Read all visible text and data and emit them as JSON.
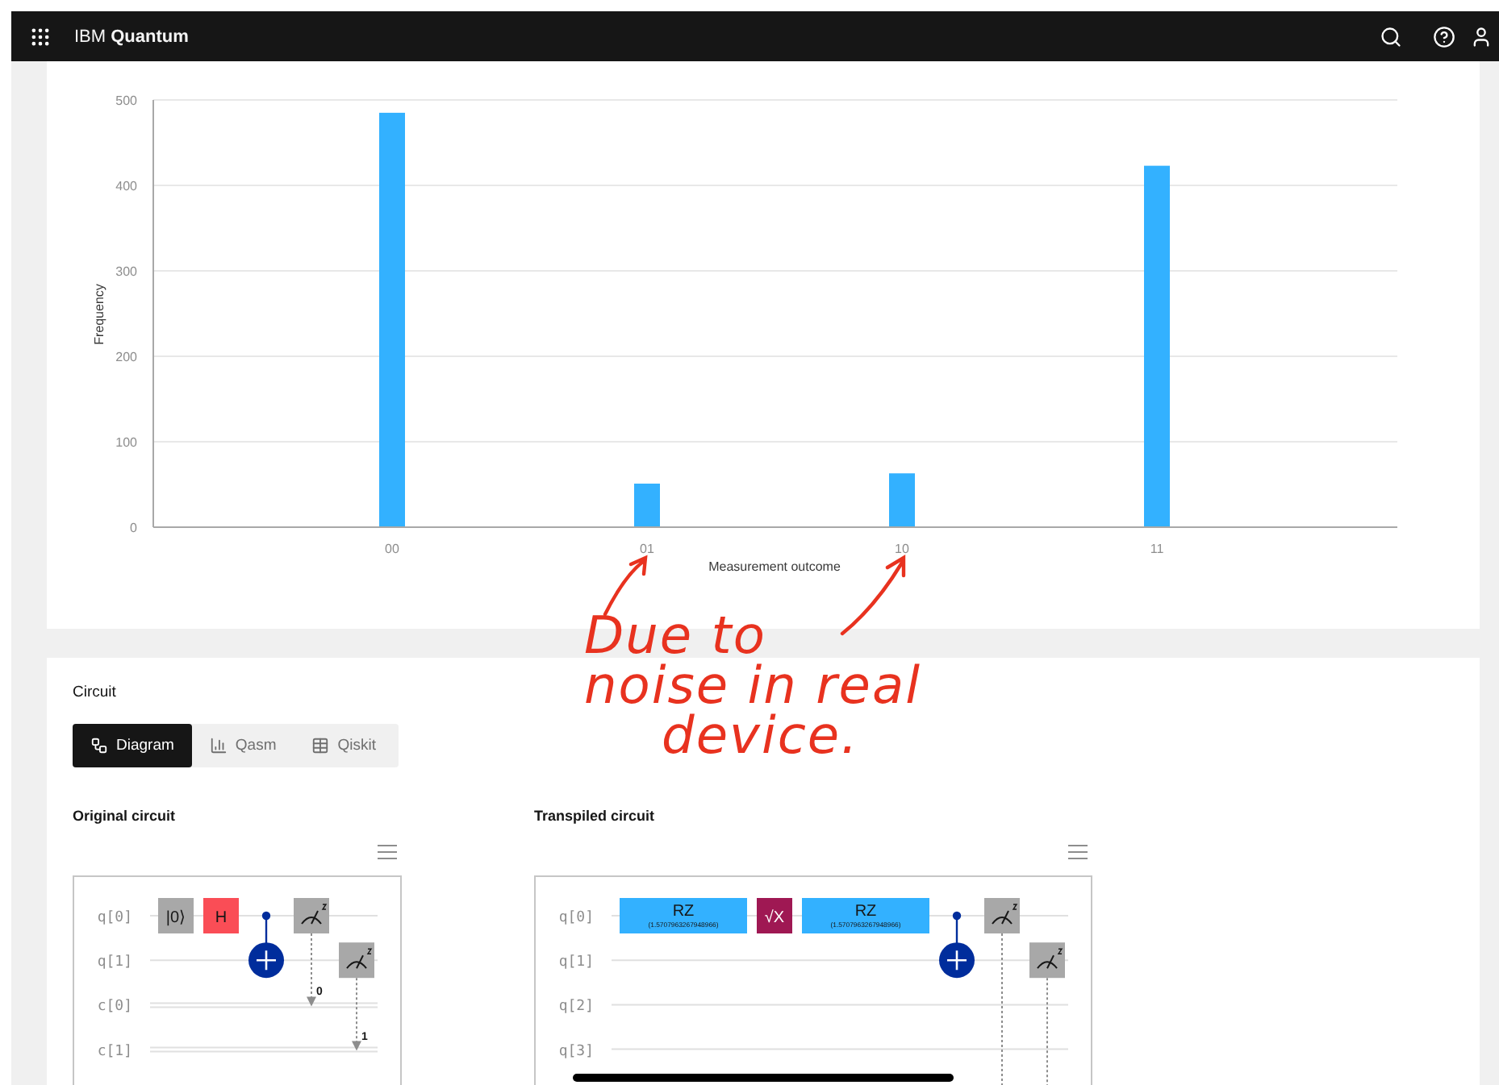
{
  "header": {
    "brand": "IBM **Quantum**"
  },
  "histogram": {
    "chart_data": {
      "type": "bar",
      "xlabel": "Measurement outcome",
      "ylabel": "Frequency",
      "categories": [
        "00",
        "01",
        "10",
        "11"
      ],
      "values": [
        485,
        51,
        63,
        423
      ],
      "ylim": [
        0,
        500
      ],
      "yticks": [
        0,
        100,
        200,
        300,
        400,
        500
      ],
      "grid": true
    }
  },
  "annotation": {
    "lines": [
      "Due to",
      "noise in real",
      "device."
    ]
  },
  "circuit": {
    "title": "Circuit",
    "tabs": [
      {
        "label": "Diagram",
        "selected": true
      },
      {
        "label": "Qasm",
        "selected": false
      },
      {
        "label": "Qiskit",
        "selected": false
      }
    ],
    "panels": [
      {
        "title": "Original circuit",
        "wires": [
          {
            "label": "q[0]",
            "kind": "quantum"
          },
          {
            "label": "q[1]",
            "kind": "quantum"
          },
          {
            "label": "c[0]",
            "kind": "classical"
          },
          {
            "label": "c[1]",
            "kind": "classical"
          }
        ],
        "steps": [
          [
            {
              "kind": "reset",
              "label": "|0⟩"
            },
            {
              "kind": "wire"
            },
            {
              "kind": "wire"
            },
            {
              "kind": "wire"
            }
          ],
          [
            {
              "kind": "h",
              "label": "H"
            },
            {
              "kind": "wire"
            },
            {
              "kind": "wire"
            },
            {
              "kind": "wire"
            }
          ],
          [
            {
              "kind": "control"
            },
            {
              "kind": "target"
            },
            {
              "kind": "wire"
            },
            {
              "kind": "wire"
            }
          ],
          [
            {
              "kind": "measure"
            },
            {
              "kind": "wire"
            },
            {
              "kind": "arrow",
              "label": "0"
            },
            {
              "kind": "wire"
            }
          ],
          [
            {
              "kind": "wire"
            },
            {
              "kind": "measure"
            },
            {
              "kind": "wire"
            },
            {
              "kind": "arrow",
              "label": "1"
            }
          ]
        ]
      },
      {
        "title": "Transpiled circuit",
        "wires": [
          {
            "label": "q[0]",
            "kind": "quantum"
          },
          {
            "label": "q[1]",
            "kind": "quantum"
          },
          {
            "label": "q[2]",
            "kind": "quantum"
          },
          {
            "label": "q[3]",
            "kind": "quantum"
          }
        ],
        "steps": [
          [
            {
              "kind": "rz",
              "label": "RZ",
              "sublabel": "(1.5707963267948966)"
            },
            {
              "kind": "wire"
            },
            {
              "kind": "wire"
            },
            {
              "kind": "wire"
            }
          ],
          [
            {
              "kind": "sx",
              "label": "√X"
            },
            {
              "kind": "wire"
            },
            {
              "kind": "wire"
            },
            {
              "kind": "wire"
            }
          ],
          [
            {
              "kind": "rz",
              "label": "RZ",
              "sublabel": "(1.5707963267948966)"
            },
            {
              "kind": "wire"
            },
            {
              "kind": "wire"
            },
            {
              "kind": "wire"
            }
          ],
          [
            {
              "kind": "control"
            },
            {
              "kind": "target"
            },
            {
              "kind": "wire"
            },
            {
              "kind": "wire"
            }
          ],
          [
            {
              "kind": "measure"
            },
            {
              "kind": "wire"
            },
            {
              "kind": "wire"
            },
            {
              "kind": "wire"
            }
          ],
          [
            {
              "kind": "wire"
            },
            {
              "kind": "measure"
            },
            {
              "kind": "wire"
            },
            {
              "kind": "wire"
            }
          ]
        ]
      }
    ]
  }
}
